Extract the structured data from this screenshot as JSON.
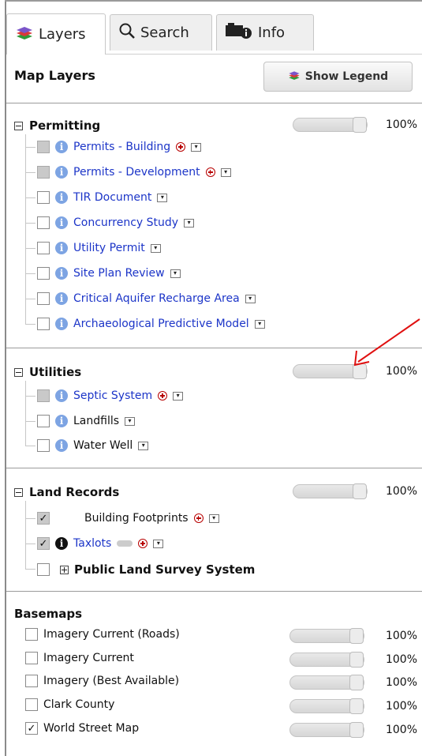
{
  "tabs": [
    {
      "label": "Layers",
      "icon": "layers-icon",
      "active": true
    },
    {
      "label": "Search",
      "icon": "magnifier-icon",
      "active": false
    },
    {
      "label": "Info",
      "icon": "info-toolbox-icon",
      "active": false
    }
  ],
  "header": {
    "title": "Map Layers",
    "legend_button": "Show Legend"
  },
  "groups": [
    {
      "title": "Permitting",
      "opacity": "100%",
      "layers": [
        {
          "name": "Permits - Building",
          "checked": false,
          "disabled": true,
          "zoom": true
        },
        {
          "name": "Permits - Development",
          "checked": false,
          "disabled": true,
          "zoom": true
        },
        {
          "name": "TIR Document",
          "checked": false,
          "disabled": false,
          "zoom": false
        },
        {
          "name": "Concurrency Study",
          "checked": false,
          "disabled": false,
          "zoom": false
        },
        {
          "name": "Utility Permit",
          "checked": false,
          "disabled": false,
          "zoom": false
        },
        {
          "name": "Site Plan Review",
          "checked": false,
          "disabled": false,
          "zoom": false
        },
        {
          "name": "Critical Aquifer Recharge Area",
          "checked": false,
          "disabled": false,
          "zoom": false
        },
        {
          "name": "Archaeological Predictive Model",
          "checked": false,
          "disabled": false,
          "zoom": false
        }
      ]
    },
    {
      "title": "Utilities",
      "opacity": "100%",
      "layers": [
        {
          "name": "Septic System",
          "checked": false,
          "disabled": true,
          "zoom": true
        },
        {
          "name": "Landfills",
          "checked": false,
          "disabled": false,
          "zoom": false
        },
        {
          "name": "Water Well",
          "checked": false,
          "disabled": false,
          "zoom": false
        }
      ]
    },
    {
      "title": "Land Records",
      "opacity": "100%",
      "layers": [
        {
          "name": "Building Footprints",
          "checked": true,
          "disabled": true
        },
        {
          "name": "Taxlots",
          "checked": true,
          "disabled": true
        },
        {
          "name": "Public Land Survey System",
          "checked": false,
          "disabled": false
        }
      ]
    }
  ],
  "basemaps": {
    "title": "Basemaps",
    "items": [
      {
        "name": "Imagery Current (Roads)",
        "checked": false,
        "opacity": "100%"
      },
      {
        "name": "Imagery Current",
        "checked": false,
        "opacity": "100%"
      },
      {
        "name": "Imagery (Best Available)",
        "checked": false,
        "opacity": "100%"
      },
      {
        "name": "Clark County",
        "checked": false,
        "opacity": "100%"
      },
      {
        "name": "World Street Map",
        "checked": true,
        "opacity": "100%"
      }
    ]
  },
  "glyphs": {
    "check": "✓",
    "chevron": "▾",
    "info": "i"
  },
  "annotation_arrow_color": "#e01010"
}
